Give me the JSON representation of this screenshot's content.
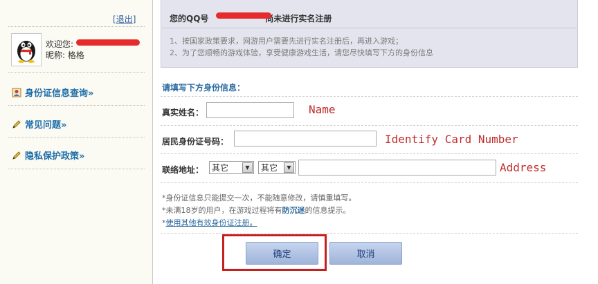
{
  "sidebar": {
    "logout_bracket_open": "[",
    "logout_label": "退出",
    "logout_bracket_close": "]",
    "welcome_label": "欢迎您:",
    "nickname_label": "昵称:",
    "nickname_value": "格格",
    "nav": [
      {
        "label": "身份证信息查询»",
        "icon": "id-card-icon"
      },
      {
        "label": "常见问题»",
        "icon": "pencil-icon"
      },
      {
        "label": "隐私保护政策»",
        "icon": "pencil-icon"
      }
    ]
  },
  "notice": {
    "title_prefix": "您的QQ号",
    "title_suffix": "尚未进行实名注册",
    "lines": [
      "1、按国家政策要求，网游用户需要先进行实名注册后，再进入游戏；",
      "2、为了您顺畅的游戏体验，享受健康游戏生活，请您尽快填写下方的身份信息"
    ]
  },
  "form": {
    "title": "请填写下方身份信息：",
    "name_label": "真实姓名：",
    "name_value": "",
    "name_annotation": "Name",
    "id_label": "居民身份证号码：",
    "id_value": "",
    "id_annotation": "Identify Card Number",
    "address_label": "联络地址：",
    "province_selected": "其它",
    "city_selected": "其它",
    "address_value": "",
    "address_annotation": "Address",
    "note1": "*身份证信息只能提交一次，不能随意修改，请慎重填写。",
    "note2_prefix": "*未满18岁的用户，在游戏过程将有",
    "note2_bold": "防沉迷",
    "note2_suffix": "的信息提示。",
    "note3_star": "*",
    "note3_link": "使用其他有效身份证注册。",
    "confirm_label": "确定",
    "cancel_label": "取消"
  },
  "colors": {
    "accent_blue": "#2c6aa0",
    "annotation_red": "#c22b2b",
    "highlight_red": "#c51f1f",
    "button_blue": "#9fb4da"
  }
}
